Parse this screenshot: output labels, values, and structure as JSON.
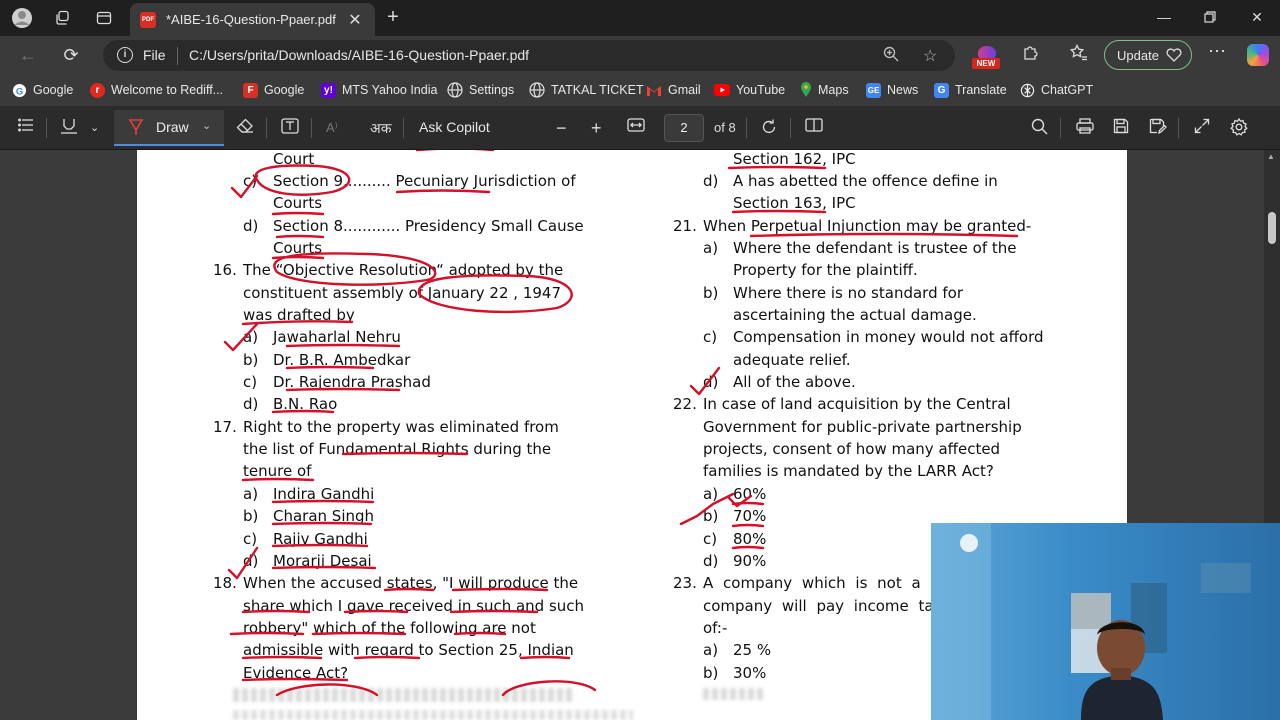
{
  "browser": {
    "tab_title": "*AIBE-16-Question-Ppaer.pdf",
    "tab_badge": "PDF",
    "address_scheme": "File",
    "address_url": "C:/Users/prita/Downloads/AIBE-16-Question-Ppaer.pdf",
    "new_badge": "NEW",
    "update_label": "Update"
  },
  "bookmarks": [
    {
      "label": "Google",
      "icon": "google-icon",
      "color": "#ffffff"
    },
    {
      "label": "Welcome to Rediff...",
      "icon": "rediff-icon",
      "color": "#e0291e"
    },
    {
      "label": "Google",
      "icon": "google-red-icon",
      "color": "#d93025"
    },
    {
      "label": "MTS Yahoo India",
      "icon": "yahoo-icon",
      "color": "#6001d2"
    },
    {
      "label": "Settings",
      "icon": "globe-icon",
      "color": "#dddddd"
    },
    {
      "label": "TATKAL TICKET",
      "icon": "globe-icon",
      "color": "#dddddd"
    },
    {
      "label": "Gmail",
      "icon": "gmail-icon",
      "color": "#ea4335"
    },
    {
      "label": "YouTube",
      "icon": "youtube-icon",
      "color": "#ff0000"
    },
    {
      "label": "Maps",
      "icon": "maps-icon",
      "color": "#34a853"
    },
    {
      "label": "News",
      "icon": "news-icon",
      "color": "#4285f4"
    },
    {
      "label": "Translate",
      "icon": "translate-icon",
      "color": "#4285f4"
    },
    {
      "label": "ChatGPT",
      "icon": "chatgpt-icon",
      "color": "#ffffff"
    }
  ],
  "pdf_toolbar": {
    "draw_label": "Draw",
    "read_aloud_glyph": "A⁾",
    "translate_glyph": "अक",
    "ask_copilot_label": "Ask Copilot",
    "current_page": "2",
    "page_total": "of 8"
  },
  "document": {
    "left_column": [
      "Court",
      "Section 9.......... Pecuniary Jurisdiction of",
      "Courts",
      "Section 8............ Presidency Small Cause",
      "Courts",
      "The “Objective Resolution“ adopted by the",
      "constituent assembly of January 22 , 1947",
      "was drafted by",
      "Jawaharlal Nehru",
      "Dr. B.R. Ambedkar",
      "Dr. Rajendra Prashad",
      "B.N. Rao",
      "Right to the property was eliminated from",
      "the list of Fundamental Rights during the",
      "tenure of",
      "Indira Gandhi",
      "Charan Singh",
      "Rajiv Gandhi",
      "Morarji Desai",
      "When the accused states, \"I will produce the",
      "share which I gave received in such and such",
      "robbery\" which of the following are not",
      "admissible with regard to Section 25, Indian",
      "Evidence Act?"
    ],
    "left_markers": [
      "c)",
      "d)",
      "16.",
      "a)",
      "b)",
      "c)",
      "d)",
      "17.",
      "a)",
      "b)",
      "c)",
      "d)",
      "18."
    ],
    "right_column": [
      "Section 162, IPC",
      "A has abetted the offence define in",
      "Section 163, IPC",
      "When Perpetual Injunction may be granted-",
      "Where the defendant is trustee of the",
      "Property for the plaintiff.",
      "Where there is no standard for",
      "ascertaining the actual damage.",
      "Compensation in money would not afford",
      "adequate relief.",
      "All of the above.",
      "In case of land acquisition by the Central",
      "Government for public-private partnership",
      "projects, consent of how many affected",
      "families is mandated by the LARR Act?",
      "60%",
      "70%",
      "80%",
      "90%",
      "A company which is not a d",
      "company will pay income tax",
      "of:-",
      "25 %",
      "30%"
    ],
    "right_markers": [
      "d)",
      "21.",
      "a)",
      "b)",
      "c)",
      "d)",
      "22.",
      "a)",
      "b)",
      "c)",
      "d)",
      "23.",
      "a)",
      "b)"
    ]
  },
  "colors": {
    "ink_red": "#d4102a",
    "ink_red_dark": "#c00018",
    "page_bg": "#ffffff",
    "chrome_bg": "#3a3a3a"
  }
}
